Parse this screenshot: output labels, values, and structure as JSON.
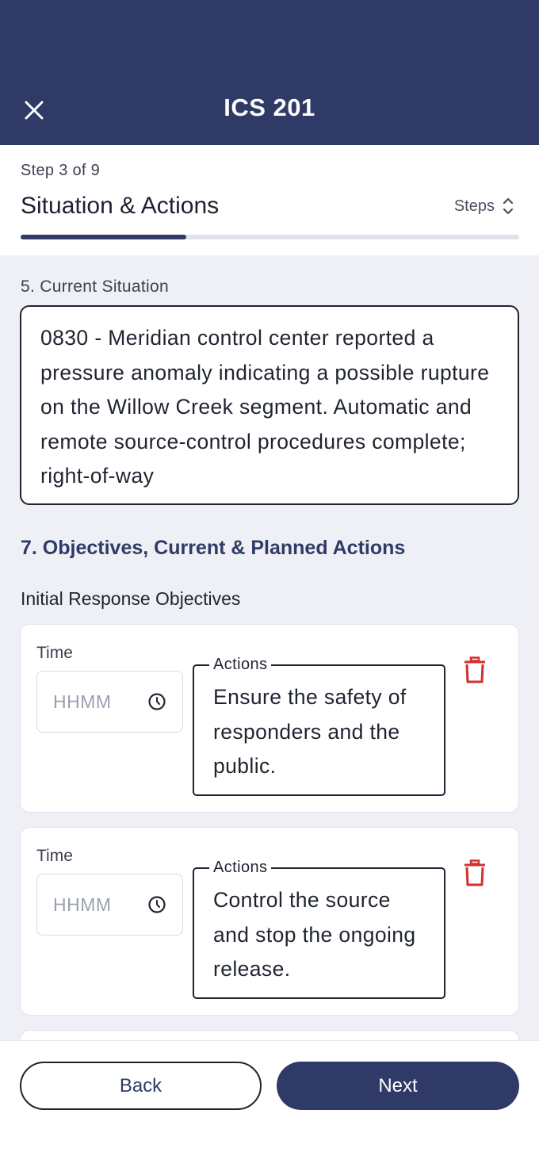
{
  "header": {
    "title": "ICS 201",
    "close_icon": "close-icon",
    "background_color": "#2f3b66"
  },
  "stepper": {
    "step_count": "Step 3 of 9",
    "title": "Situation & Actions",
    "steps_label": "Steps",
    "steps_icon": "chevron-up-down-icon",
    "progress": 0.333
  },
  "situation": {
    "label": "5. Current Situation",
    "text": "0830 - Meridian control center reported a pressure anomaly indicating a possible rupture on the Willow Creek segment. Automatic and remote source-control procedures complete; right-of-way"
  },
  "objectives": {
    "section_heading": "7. Objectives, Current & Planned Actions",
    "sub_heading": "Initial Response Objectives",
    "items": [
      {
        "time_label": "Time",
        "time_placeholder": "HHMM",
        "actions_label": "Actions",
        "actions_text": "Ensure the safety of responders and the public."
      },
      {
        "time_label": "Time",
        "time_placeholder": "HHMM",
        "actions_label": "Actions",
        "actions_text": "Control the source and stop the ongoing release."
      }
    ]
  },
  "footer": {
    "back_label": "Back",
    "next_label": "Next"
  },
  "colors": {
    "primary": "#2f3b66",
    "delete": "#d32f2f",
    "content_bg": "#eef0f5"
  }
}
